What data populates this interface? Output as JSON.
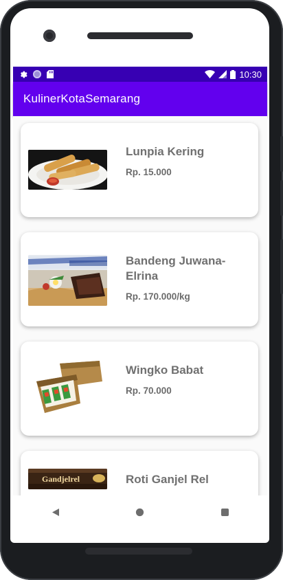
{
  "status_bar": {
    "time": "10:30",
    "left_icons": [
      "gear-icon",
      "circle-icon",
      "sd-card-icon"
    ],
    "right_icons": [
      "wifi-icon",
      "signal-icon",
      "battery-icon"
    ]
  },
  "app_bar": {
    "title": "KulinerKotaSemarang",
    "color": "#6200ee",
    "status_color": "#3700b3"
  },
  "items": [
    {
      "name": "Lunpia Kering",
      "price": "Rp. 15.000",
      "image": "lunpia-image"
    },
    {
      "name": "Bandeng Juwana-Elrina",
      "price": "Rp. 170.000/kg",
      "image": "bandeng-image"
    },
    {
      "name": "Wingko Babat",
      "price": "Rp. 70.000",
      "image": "wingko-image"
    },
    {
      "name": "Roti Ganjel Rel",
      "price": "",
      "image": "roti-image",
      "image_text": "Gandjelrel"
    }
  ],
  "nav_bar": {
    "icons": [
      "back-icon",
      "home-icon",
      "recents-icon"
    ]
  }
}
